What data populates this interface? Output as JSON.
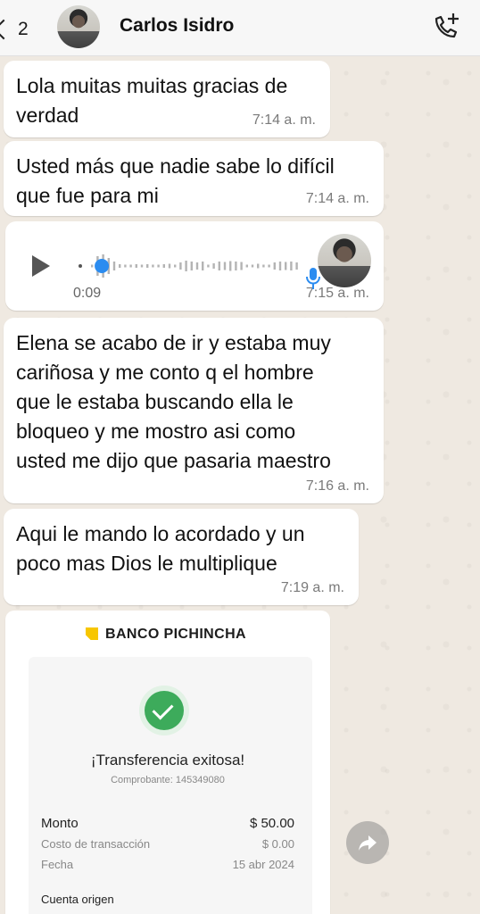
{
  "header": {
    "back_count": "2",
    "contact_name": "Carlos Isidro"
  },
  "messages": [
    {
      "text_lines": [
        "Lola muitas muitas gracias de",
        "verdad"
      ],
      "time": "7:14 a. m."
    },
    {
      "text_lines": [
        "Usted más que nadie sabe lo difícil",
        "que fue para mi"
      ],
      "time": "7:14 a. m."
    },
    {
      "voice": {
        "duration": "0:09",
        "played_fraction": 0.05
      },
      "time": "7:15 a. m."
    },
    {
      "text_lines": [
        "Elena se acabo de ir y estaba muy",
        "cariñosa y me conto q el hombre",
        "que le estaba buscando ella le",
        "bloqueo y me mostro asi como",
        "usted me dijo que pasaria maestro"
      ],
      "time": "7:16 a. m."
    },
    {
      "text_lines": [
        "Aqui le mando lo acordado y un",
        "poco mas Dios le multiplique"
      ],
      "time": "7:19 a. m."
    }
  ],
  "receipt": {
    "bank_name": "BANCO PICHINCHA",
    "title": "¡Transferencia exitosa!",
    "comprobante": "Comprobante: 145349080",
    "rows": [
      {
        "label": "Monto",
        "value": "$ 50.00"
      },
      {
        "label": "Costo de transacción",
        "value": "$ 0.00"
      },
      {
        "label": "Fecha",
        "value": "15 abr 2024"
      }
    ],
    "section": "Cuenta origen"
  },
  "icons": {
    "call": "phone-plus-icon",
    "share": "forward-arrow-icon",
    "mic": "mic-icon",
    "play": "play-icon",
    "bank_mark": "pichincha-logo-icon",
    "check": "check-circle-icon"
  },
  "colors": {
    "accent_blue": "#2b8cf0",
    "success_green": "#3dab5b",
    "bank_yellow": "#f7c600"
  }
}
